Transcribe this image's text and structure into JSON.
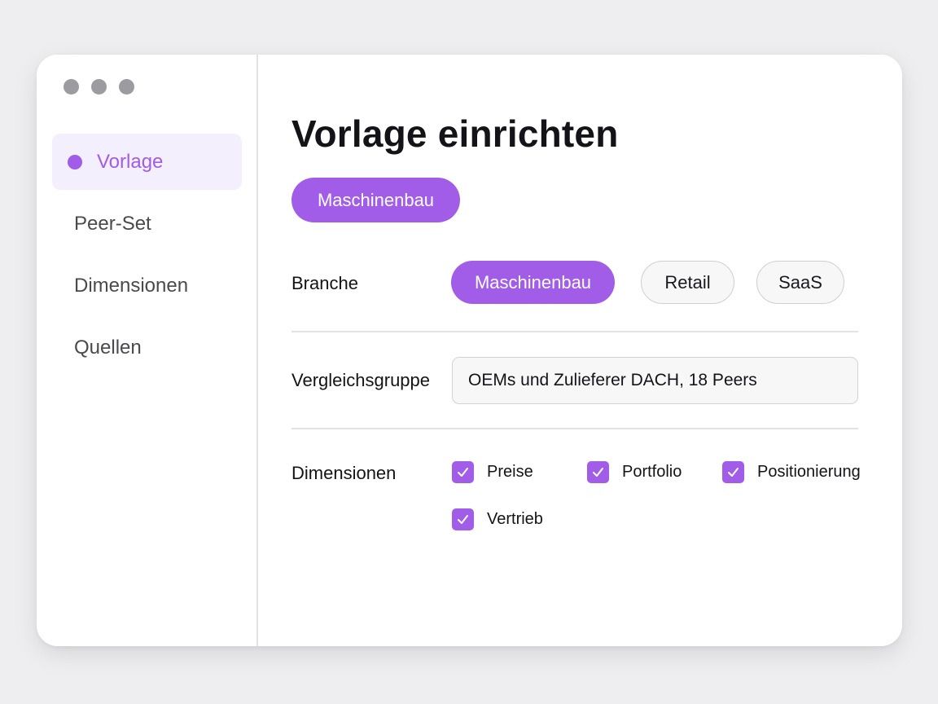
{
  "window": {
    "controls": [
      "close",
      "minimize",
      "maximize"
    ]
  },
  "sidebar": {
    "items": [
      {
        "label": "Vorlage",
        "active": true
      },
      {
        "label": "Peer-Set",
        "active": false
      },
      {
        "label": "Dimensionen",
        "active": false
      },
      {
        "label": "Quellen",
        "active": false
      }
    ]
  },
  "main": {
    "title": "Vorlage einrichten",
    "header_pill": "Maschinenbau",
    "branche": {
      "label": "Branche",
      "options": [
        "Maschinenbau",
        "Retail",
        "SaaS"
      ],
      "selected": "Maschinenbau"
    },
    "vergleichsgruppe": {
      "label": "Vergleichsgruppe",
      "value": "OEMs und Zulieferer DACH, 18 Peers"
    },
    "dimensionen": {
      "label": "Dimensionen",
      "items": [
        {
          "label": "Preise",
          "checked": true
        },
        {
          "label": "Portfolio",
          "checked": true
        },
        {
          "label": "Positionierung",
          "checked": true
        },
        {
          "label": "Vertrieb",
          "checked": true
        }
      ]
    }
  },
  "colors": {
    "accent": "#a15ce8",
    "accent_light": "#f4effc",
    "text": "#141418",
    "muted": "#4a4a4e",
    "border": "#e3e3e6"
  },
  "icons": {
    "window_control": "circle-dot",
    "checkbox": "check-icon"
  }
}
